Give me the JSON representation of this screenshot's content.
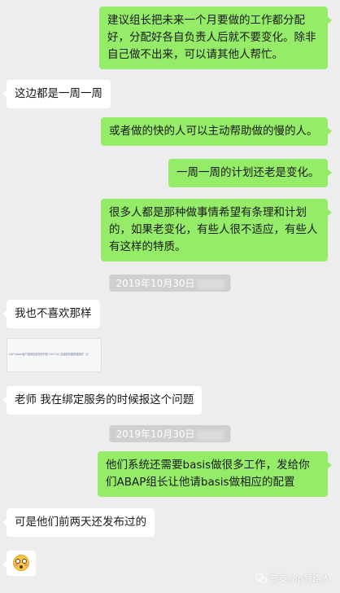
{
  "messages": {
    "m1": "建议组长把未来一个月要做的工作都分配好，分配好各自负责人后就不要变化。除非自己做不出来，可以请其他人帮忙。",
    "m2": "这边都是一周一周",
    "m3": "或者做的快的人可以主动帮助做的慢的人。",
    "m4": "一周一周的计划还老是变化。",
    "m5": "很多人都是那种做事情希望有条理和计划的，如果老变化，有些人很不适应，有些人有这样的特质。",
    "t1": "2019年10月30日",
    "m6": "我也不喜欢那样",
    "m7_thumb_text": "SAP odata客户端绑定服务的时候 SAP GUI 连接服务器报错服务（已",
    "m8": "老师  我在绑定服务的时候报这个问题",
    "t2": "2019年10月30日",
    "m9": "他们系统还需要basis做很多工作，发给你们ABAP组长让他请basis做相应的配置",
    "m10": "可是他们前两天还发布过的",
    "m11_emoji": "flushed-face-emoji"
  },
  "watermark": {
    "text": "普泰sap领路人"
  },
  "colors": {
    "sent": "#95ec69",
    "received": "#ffffff",
    "background": "#ededed"
  }
}
